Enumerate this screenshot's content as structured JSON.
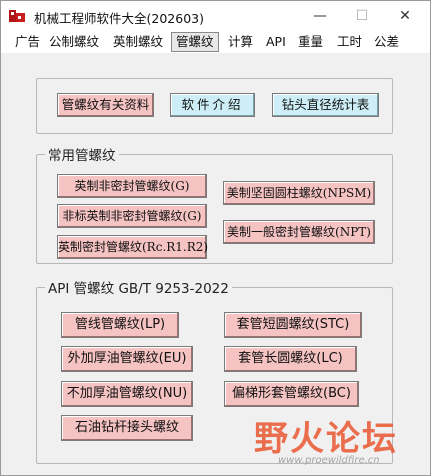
{
  "window": {
    "title": "机械工程师软件大全(202603)",
    "minimize_glyph": "—",
    "maximize_glyph": "☐",
    "close_glyph": "✕"
  },
  "menu": {
    "items": [
      "广告",
      "公制螺纹",
      "英制螺纹",
      "管螺纹",
      "计算",
      "API",
      "重量",
      "工时",
      "公差"
    ],
    "active": "管螺纹"
  },
  "toolbar_buttons": {
    "info": "管螺纹有关资料",
    "intro": "软件介绍",
    "drill_stats": "钻头直径统计表"
  },
  "common_group": {
    "title": "常用管螺纹",
    "buttons": {
      "bsp_nonseal": "英制非密封管螺纹(G)",
      "nonstd_bsp_nonseal": "非标英制非密封管螺纹(G)",
      "bsp_seal": "英制密封管螺纹(Rc.R1.R2)",
      "us_fuel_thread": "美制坚固圆柱螺纹(NPSM)",
      "us_general_seal": "美制一般密封管螺纹(NPT)"
    }
  },
  "api_group": {
    "title": "API 管螺纹 GB/T 9253-2022",
    "buttons": {
      "line_pipe": "管线管螺纹(LP)",
      "external_upset": "外加厚油管螺纹(EU)",
      "non_upset": "不加厚油管螺纹(NU)",
      "drill_rod": "石油钻杆接头螺纹",
      "short_round": "套管短圆螺纹(STC)",
      "long_round": "套管长圆螺纹(LC)",
      "buttress": "偏梯形套管螺纹(BC)"
    }
  },
  "watermark": {
    "main": "野火论坛",
    "sub": "www.proewildfire.cn"
  },
  "colors": {
    "pink_button": "#f6c3c3",
    "cyan_button": "#cdeef6",
    "watermark": "#e85028"
  }
}
